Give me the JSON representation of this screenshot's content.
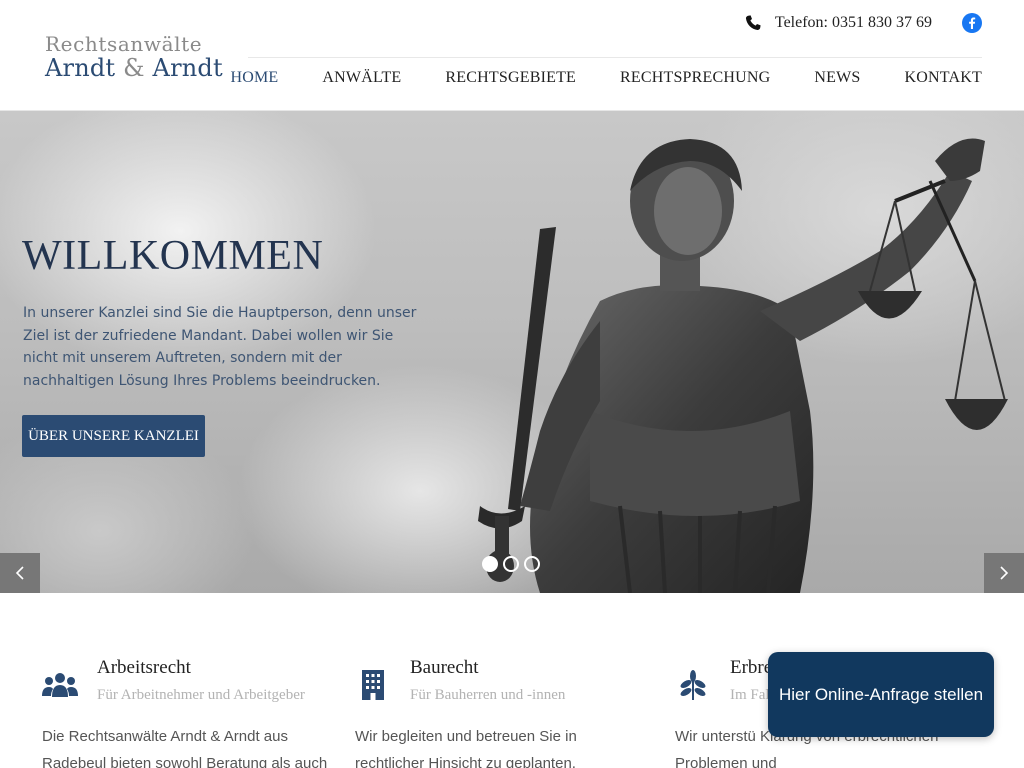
{
  "brand": {
    "line1": "Rechtsanwälte",
    "name_a": "Arndt",
    "amp": "&",
    "name_b": "Arndt",
    "primary_color": "#2b4b73"
  },
  "topbar": {
    "phone_icon": "phone-icon",
    "phone": "Telefon: 0351 830 37 69",
    "social_icon": "facebook-icon"
  },
  "nav": {
    "items": [
      {
        "label": "HOME",
        "active": true
      },
      {
        "label": "ANWÄLTE",
        "active": false
      },
      {
        "label": "RECHTSGEBIETE",
        "active": false
      },
      {
        "label": "RECHTSPRECHUNG",
        "active": false
      },
      {
        "label": "NEWS",
        "active": false
      },
      {
        "label": "KONTAKT",
        "active": false
      }
    ]
  },
  "hero": {
    "title": "WILLKOMMEN",
    "text": "In unserer Kanzlei sind Sie die Hauptperson, denn unser Ziel ist der zufriedene Mandant. Dabei wollen wir Sie nicht mit unserem Auftreten, sondern mit der nachhaltigen Lösung Ihres Problems beeindrucken.",
    "button": "ÜBER UNSERE KANZLEI",
    "prev_icon": "chevron-left-icon",
    "next_icon": "chevron-right-icon",
    "slides": 3,
    "active_slide": 1
  },
  "services": [
    {
      "icon": "people-icon",
      "title": "Arbeitsrecht",
      "subtitle": "Für Arbeitnehmer und Arbeitgeber",
      "text": "Die Rechtsanwälte Arndt & Arndt aus Radebeul bieten sowohl Beratung als auch"
    },
    {
      "icon": "building-icon",
      "title": "Baurecht",
      "subtitle": "Für Bauherren und -innen",
      "text": "Wir begleiten und betreuen Sie in rechtlicher Hinsicht zu geplanten,"
    },
    {
      "icon": "leaf-icon",
      "title": "Erbre",
      "subtitle": "Im Fal",
      "text": "Wir unterstü Klärung von erbrechtlichen Problemen und"
    }
  ],
  "cta": {
    "label": "Hier Online-Anfrage stellen"
  }
}
